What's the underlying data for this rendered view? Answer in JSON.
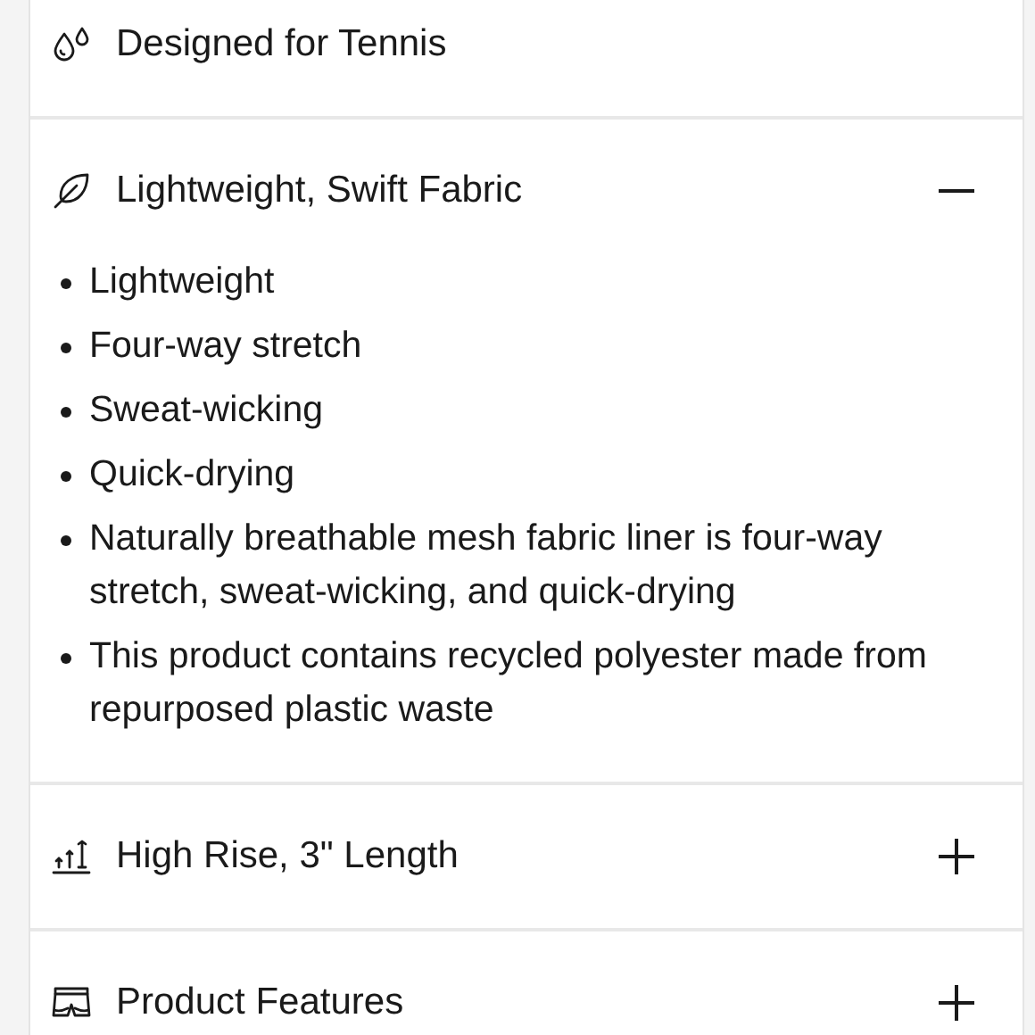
{
  "sections": [
    {
      "kind": "static",
      "title": "Designed for Tennis"
    },
    {
      "kind": "accordion",
      "title": "Lightweight, Swift Fabric",
      "expanded": true,
      "items": [
        "Lightweight",
        "Four-way stretch",
        "Sweat-wicking",
        "Quick-drying",
        "Naturally breathable mesh fabric liner is four-way stretch, sweat-wicking, and quick-drying",
        "This product contains recycled polyester made from repurposed plastic waste"
      ]
    },
    {
      "kind": "accordion",
      "title": "High Rise, 3\" Length",
      "expanded": false
    },
    {
      "kind": "accordion",
      "title": "Product Features",
      "expanded": false
    }
  ]
}
